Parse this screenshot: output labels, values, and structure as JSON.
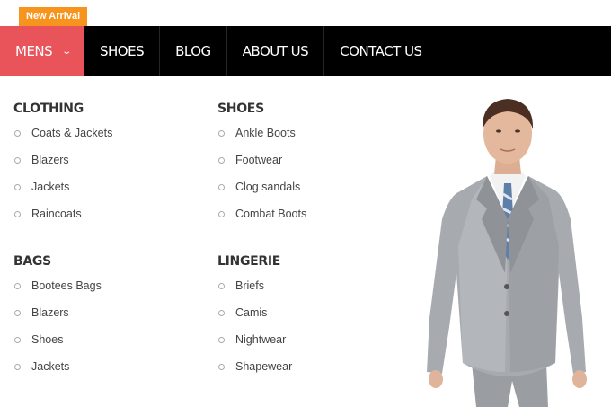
{
  "badge": {
    "label": "New Arrival",
    "color": "#f7941d"
  },
  "nav": {
    "items": [
      {
        "label": "MENS",
        "active": true
      },
      {
        "label": "SHOES",
        "active": false
      },
      {
        "label": "BLOG",
        "active": false
      },
      {
        "label": "ABOUT US",
        "active": false
      },
      {
        "label": "CONTACT US",
        "active": false
      }
    ],
    "active_color": "#e8545a",
    "bar_color": "#000000"
  },
  "mega_menu": {
    "sections": [
      {
        "title": "CLOTHING",
        "items": [
          "Coats & Jackets",
          "Blazers",
          "Jackets",
          "Raincoats"
        ]
      },
      {
        "title": "SHOES",
        "items": [
          "Ankle Boots",
          "Footwear",
          "Clog sandals",
          "Combat Boots"
        ]
      },
      {
        "title": "BAGS",
        "items": [
          "Bootees Bags",
          "Blazers",
          "Shoes",
          "Jackets"
        ]
      },
      {
        "title": "LINGERIE",
        "items": [
          "Briefs",
          "Camis",
          "Nightwear",
          "Shapewear"
        ]
      }
    ],
    "image": "man-in-grey-suit"
  }
}
